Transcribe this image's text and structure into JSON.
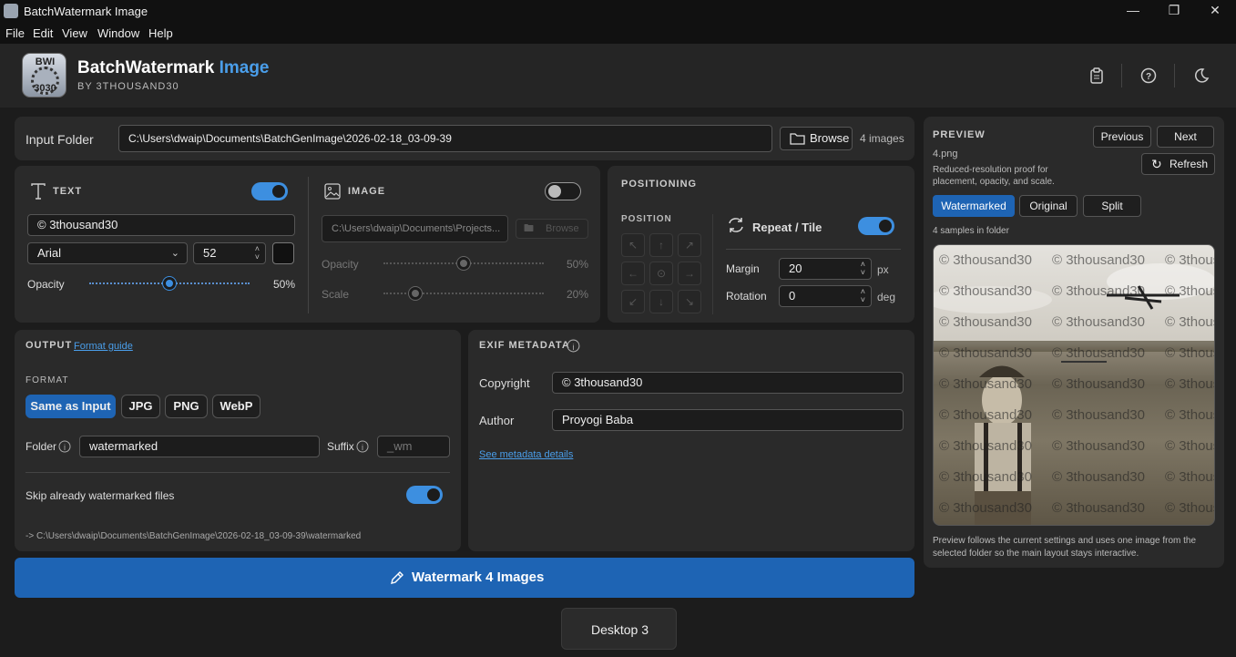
{
  "window": {
    "title": "BatchWatermark Image"
  },
  "menu": [
    "File",
    "Edit",
    "View",
    "Window",
    "Help"
  ],
  "header": {
    "logo_top": "BWI",
    "logo_bottom": "3030",
    "brand": "BatchWatermark",
    "brand_accent": "Image",
    "byline": "BY 3THOUSAND30"
  },
  "input": {
    "label": "Input Folder",
    "path": "C:\\Users\\dwaip\\Documents\\BatchGenImage\\2026-02-18_03-09-39",
    "browse": "Browse",
    "count": "4 images"
  },
  "text_panel": {
    "title": "TEXT",
    "enabled": true,
    "text": "© 3thousand30",
    "font": "Arial",
    "size": "52",
    "color": "#111111",
    "opacity_label": "Opacity",
    "opacity": "50%",
    "opacity_fraction": 0.5
  },
  "image_panel": {
    "title": "IMAGE",
    "enabled": false,
    "path": "C:\\Users\\dwaip\\Documents\\Projects...",
    "browse": "Browse",
    "opacity_label": "Opacity",
    "opacity": "50%",
    "opacity_fraction": 0.5,
    "scale_label": "Scale",
    "scale": "20%",
    "scale_fraction": 0.2
  },
  "positioning": {
    "title": "POSITIONING",
    "position_label": "POSITION",
    "repeat_label": "Repeat / Tile",
    "repeat": true,
    "margin_label": "Margin",
    "margin": "20",
    "margin_unit": "px",
    "rotation_label": "Rotation",
    "rotation": "0",
    "rotation_unit": "deg"
  },
  "output": {
    "title": "OUTPUT",
    "guide": "Format guide",
    "format_label": "FORMAT",
    "formats": [
      "Same as Input",
      "JPG",
      "PNG",
      "WebP"
    ],
    "selected_format": "Same as Input",
    "folder_label": "Folder",
    "folder": "watermarked",
    "suffix_label": "Suffix",
    "suffix_placeholder": "_wm",
    "skip_label": "Skip already watermarked files",
    "skip": true,
    "dest": "-> C:\\Users\\dwaip\\Documents\\BatchGenImage\\2026-02-18_03-09-39\\watermarked"
  },
  "exif": {
    "title": "EXIF METADATA",
    "copyright_label": "Copyright",
    "copyright": "© 3thousand30",
    "author_label": "Author",
    "author": "Proyogi Baba",
    "details": "See metadata details"
  },
  "action": {
    "label": "Watermark 4 Images"
  },
  "preview": {
    "title": "PREVIEW",
    "file": "4.png",
    "desc": "Reduced-resolution proof for placement, opacity, and scale.",
    "prev": "Previous",
    "next": "Next",
    "refresh": "Refresh",
    "modes": [
      "Watermarked",
      "Original",
      "Split"
    ],
    "selected_mode": "Watermarked",
    "samples": "4 samples in folder",
    "watermark_text": "© 3thousand30",
    "note": "Preview follows the current settings and uses one image from the selected folder so the main layout stays interactive."
  },
  "taskbar": {
    "desktop": "Desktop 3"
  }
}
